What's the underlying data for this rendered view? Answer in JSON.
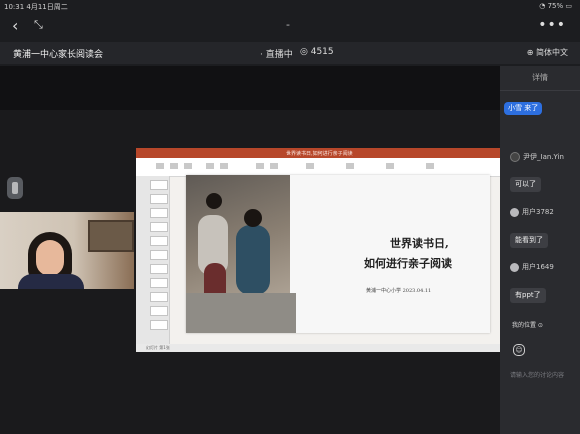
{
  "status_bar": {
    "time_date": "10:31  4月11日周二",
    "battery": "75%"
  },
  "top_nav": {
    "back_icon": "‹",
    "shrink_icon": "⤡",
    "title_dash": "-",
    "more_icon": "•••"
  },
  "stream": {
    "title": "黄浦一中心家长阅读会",
    "live_label": "直播中",
    "viewers": "4515",
    "language": "简体中文"
  },
  "slide": {
    "window_title": "世界读书日,如何进行亲子阅读",
    "headline_1": "世界读书日,",
    "headline_2": "如何进行亲子阅读",
    "subtitle": "黄浦一中心小学 2023.04.11",
    "status_left": "幻灯片 第1张"
  },
  "panel": {
    "tab_label": "详情",
    "welcome_message": "小雪 来了",
    "messages": [
      {
        "user": "尹伊_Ian.Yin",
        "text": "可以了"
      },
      {
        "user": "用户3782",
        "text": "能看到了"
      },
      {
        "user": "用户1649",
        "text": "有ppt了"
      }
    ],
    "location_label": "我的位置",
    "input_placeholder": "请输入您的讨论内容"
  },
  "colors": {
    "accent": "#2d6fe0",
    "ppt_brand": "#b7472a",
    "panel_bg": "#2a2b2f"
  }
}
